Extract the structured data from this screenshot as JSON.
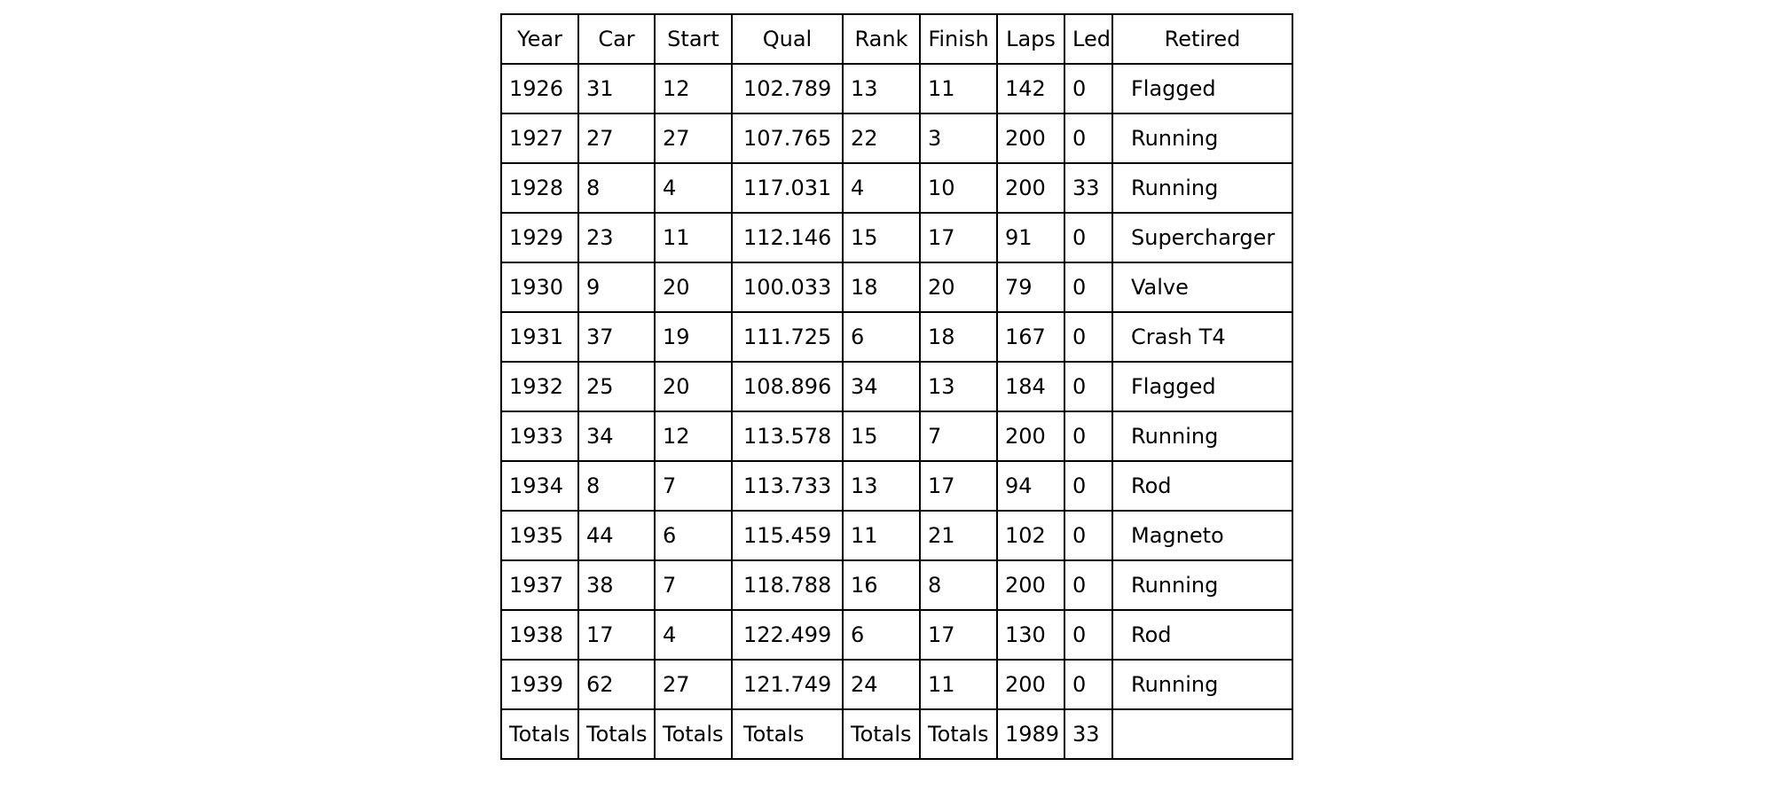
{
  "chart_data": {
    "type": "table",
    "columns": [
      "Year",
      "Car",
      "Start",
      "Qual",
      "Rank",
      "Finish",
      "Laps",
      "Led",
      "Retired"
    ],
    "rows": [
      [
        "1926",
        "31",
        "12",
        "102.789",
        "13",
        "11",
        "142",
        "0",
        "Flagged"
      ],
      [
        "1927",
        "27",
        "27",
        "107.765",
        "22",
        "3",
        "200",
        "0",
        "Running"
      ],
      [
        "1928",
        "8",
        "4",
        "117.031",
        "4",
        "10",
        "200",
        "33",
        "Running"
      ],
      [
        "1929",
        "23",
        "11",
        "112.146",
        "15",
        "17",
        "91",
        "0",
        "Supercharger"
      ],
      [
        "1930",
        "9",
        "20",
        "100.033",
        "18",
        "20",
        "79",
        "0",
        "Valve"
      ],
      [
        "1931",
        "37",
        "19",
        "111.725",
        "6",
        "18",
        "167",
        "0",
        "Crash T4"
      ],
      [
        "1932",
        "25",
        "20",
        "108.896",
        "34",
        "13",
        "184",
        "0",
        "Flagged"
      ],
      [
        "1933",
        "34",
        "12",
        "113.578",
        "15",
        "7",
        "200",
        "0",
        "Running"
      ],
      [
        "1934",
        "8",
        "7",
        "113.733",
        "13",
        "17",
        "94",
        "0",
        "Rod"
      ],
      [
        "1935",
        "44",
        "6",
        "115.459",
        "11",
        "21",
        "102",
        "0",
        "Magneto"
      ],
      [
        "1937",
        "38",
        "7",
        "118.788",
        "16",
        "8",
        "200",
        "0",
        "Running"
      ],
      [
        "1938",
        "17",
        "4",
        "122.499",
        "6",
        "17",
        "130",
        "0",
        "Rod"
      ],
      [
        "1939",
        "62",
        "27",
        "121.749",
        "24",
        "11",
        "200",
        "0",
        "Running"
      ],
      [
        "Totals",
        "Totals",
        "Totals",
        "Totals",
        "Totals",
        "Totals",
        "1989",
        "33",
        ""
      ]
    ]
  }
}
